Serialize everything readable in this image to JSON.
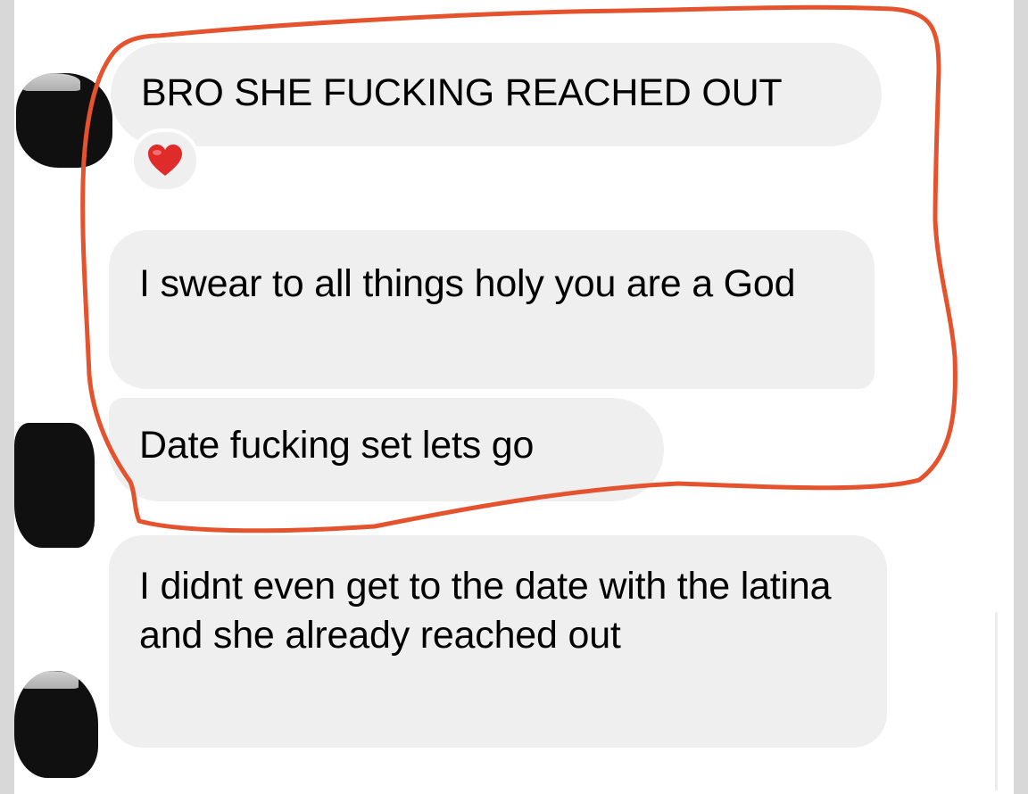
{
  "conversation": {
    "messages": [
      {
        "text": "BRO SHE FUCKING REACHED OUT",
        "reaction": "heart-emoji"
      },
      {
        "text": "I swear to all things holy you are a God"
      },
      {
        "text": "Date fucking set lets go"
      },
      {
        "text": "I didnt even get to the date with the latina and she already reached out"
      }
    ]
  },
  "colors": {
    "bubble": "#efefef",
    "annotation": "#e5532e",
    "heart": "#e02b2b"
  }
}
